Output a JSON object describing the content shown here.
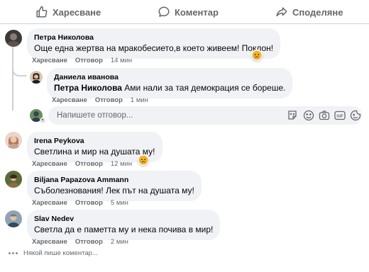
{
  "action_bar": {
    "like_label": "Харесване",
    "comment_label": "Коментар",
    "share_label": "Споделяне"
  },
  "comments": [
    {
      "author": "Петра Николова",
      "text": "Още една жертва на мракобесието,в което живеем! Поклон!",
      "like_action": "Харесване",
      "reply_action": "Отговор",
      "time": "14 мин",
      "reaction": "sad-reaction-icon"
    },
    {
      "author": "Даниела иванова",
      "mention": "Петра Николова",
      "text": " Ами нали за тая демокрация се бореше.",
      "like_action": "Харесване",
      "reply_action": "Отговор",
      "time": "1 мин"
    },
    {
      "author": "Irena Peykova",
      "text": "Светлина и мир на душата му!",
      "like_action": "Харесване",
      "reply_action": "Отговор",
      "time": "12 мин",
      "reaction": "sad-reaction-icon"
    },
    {
      "author": "Biljana Papazova Ammann",
      "text": "Съболезнования! Лек път на душата му!",
      "like_action": "Харесване",
      "reply_action": "Отговор",
      "time": "5 мин"
    },
    {
      "author": "Slav Nedev",
      "text": "Светла да е паметта му и нека почива в мир!",
      "like_action": "Харесване",
      "reply_action": "Отговор",
      "time": "2 мин"
    }
  ],
  "reply_box": {
    "placeholder": "Напишете отговор..."
  },
  "typing_indicator": "Някой пише коментар...",
  "colors": {
    "bubble_bg": "#f0f2f5",
    "secondary_text": "#65676b",
    "sad_reaction": "#f7b125"
  }
}
